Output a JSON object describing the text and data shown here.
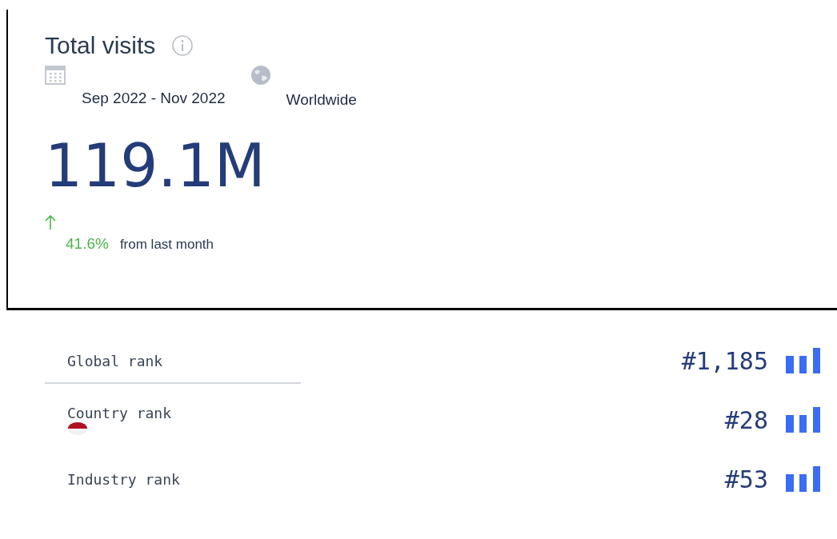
{
  "card": {
    "title": "Total visits",
    "date_range": "Sep 2022 - Nov 2022",
    "region": "Worldwide",
    "value": "119.1M",
    "change": "41.6%",
    "change_note": "from last month"
  },
  "ranks": [
    {
      "label": "Global rank",
      "value": "#1,185",
      "kind": "plain",
      "divider": true
    },
    {
      "label": "Country rank",
      "value": "#28",
      "kind": "flag",
      "divider": false
    },
    {
      "label": "Industry rank",
      "value": "#53",
      "kind": "plain",
      "divider": false
    }
  ]
}
